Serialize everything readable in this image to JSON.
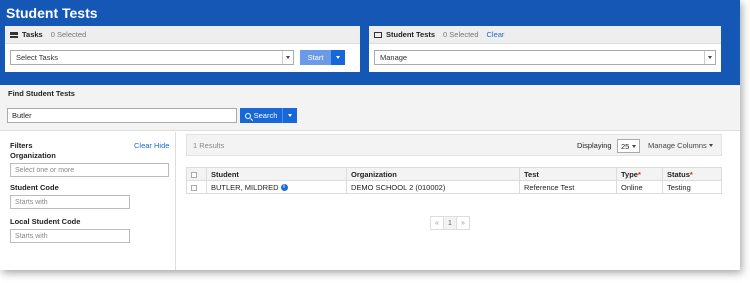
{
  "page_title": "Student Tests",
  "tasks_panel": {
    "title": "Tasks",
    "selected": "0 Selected",
    "select_value": "Select Tasks",
    "start_label": "Start"
  },
  "tests_panel": {
    "title": "Student Tests",
    "selected": "0 Selected",
    "clear_label": "Clear",
    "select_value": "Manage"
  },
  "find": {
    "title": "Find Student Tests",
    "search_value": "Butler",
    "search_label": "Search"
  },
  "filters": {
    "title": "Filters",
    "clear_label": "Clear",
    "hide_label": "Hide",
    "organization_label": "Organization",
    "organization_placeholder": "Select one or more",
    "student_code_label": "Student Code",
    "student_code_placeholder": "Starts with",
    "local_code_label": "Local Student Code",
    "local_code_placeholder": "Starts with"
  },
  "results": {
    "count_text": "1 Results",
    "displaying_label": "Displaying",
    "per_page": "25",
    "manage_columns_label": "Manage Columns",
    "columns": [
      "Student",
      "Organization",
      "Test",
      "Type",
      "Status"
    ],
    "rows": [
      {
        "student": "BUTLER, MILDRED",
        "organization": "DEMO SCHOOL 2 (010002)",
        "test": "Reference Test",
        "type": "Online",
        "status": "Testing"
      }
    ],
    "pager": {
      "prev": "«",
      "page": "1",
      "next": "»"
    }
  },
  "colors": {
    "header_blue": "#1557b5",
    "button_blue": "#1767d9",
    "link_blue": "#1a6dcc"
  }
}
